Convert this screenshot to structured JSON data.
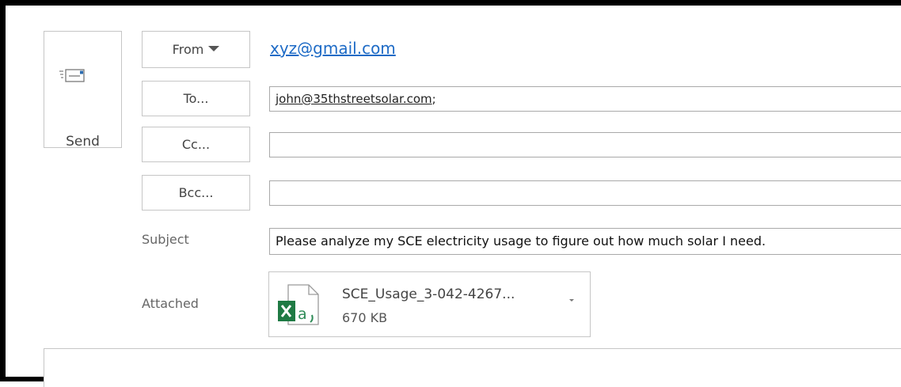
{
  "send": {
    "label": "Send",
    "icon": "send-envelope-icon"
  },
  "from": {
    "button_label": "From",
    "address": "xyz@gmail.com"
  },
  "to": {
    "button_label": "To...",
    "value": "john@35thstreetsolar.com",
    "separator": ";"
  },
  "cc": {
    "button_label": "Cc...",
    "value": ""
  },
  "bcc": {
    "button_label": "Bcc...",
    "value": ""
  },
  "subject": {
    "label": "Subject",
    "value": "Please analyze my SCE electricity usage to figure out how much solar I need."
  },
  "attachment": {
    "label": "Attached",
    "file_name": "SCE_Usage_3-042-4267...",
    "file_size": "670 KB",
    "icon": "excel-file-icon"
  },
  "colors": {
    "accent_link": "#1e6bc6",
    "excel_green": "#1f7a44",
    "border": "#c6c6c6"
  }
}
